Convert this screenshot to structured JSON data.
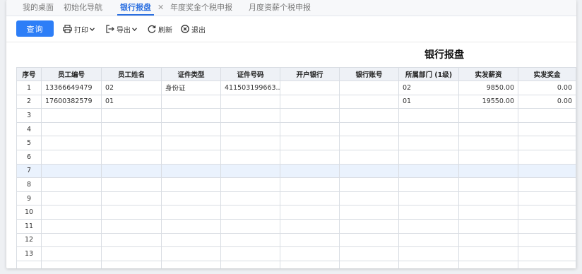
{
  "tabs": [
    {
      "label": "我的桌面",
      "active": false
    },
    {
      "label": "初始化导航",
      "active": false
    },
    {
      "label": "银行报盘",
      "active": true
    },
    {
      "label": "年度奖金个税申报",
      "active": false
    },
    {
      "label": "月度资薪个税申报",
      "active": false
    }
  ],
  "toolbar": {
    "query_label": "查询",
    "print_label": "打印",
    "export_label": "导出",
    "refresh_label": "刷新",
    "exit_label": "退出"
  },
  "report": {
    "title": "银行报盘"
  },
  "table": {
    "columns": [
      "序号",
      "员工编号",
      "员工姓名",
      "证件类型",
      "证件号码",
      "开户银行",
      "银行账号",
      "所属部门 (1级)",
      "实发薪资",
      "实发奖金"
    ],
    "rows": [
      [
        "1",
        "13366649479",
        "02",
        "身份证",
        "411503199663...",
        "",
        "",
        "02",
        "9850.00",
        "0.00"
      ],
      [
        "2",
        "17600382579",
        "01",
        "",
        "",
        "",
        "",
        "01",
        "19550.00",
        "0.00"
      ],
      [
        "3",
        "",
        "",
        "",
        "",
        "",
        "",
        "",
        "",
        ""
      ],
      [
        "4",
        "",
        "",
        "",
        "",
        "",
        "",
        "",
        "",
        ""
      ],
      [
        "5",
        "",
        "",
        "",
        "",
        "",
        "",
        "",
        "",
        ""
      ],
      [
        "6",
        "",
        "",
        "",
        "",
        "",
        "",
        "",
        "",
        ""
      ],
      [
        "7",
        "",
        "",
        "",
        "",
        "",
        "",
        "",
        "",
        ""
      ],
      [
        "8",
        "",
        "",
        "",
        "",
        "",
        "",
        "",
        "",
        ""
      ],
      [
        "9",
        "",
        "",
        "",
        "",
        "",
        "",
        "",
        "",
        ""
      ],
      [
        "10",
        "",
        "",
        "",
        "",
        "",
        "",
        "",
        "",
        ""
      ],
      [
        "11",
        "",
        "",
        "",
        "",
        "",
        "",
        "",
        "",
        ""
      ],
      [
        "12",
        "",
        "",
        "",
        "",
        "",
        "",
        "",
        "",
        ""
      ],
      [
        "13",
        "",
        "",
        "",
        "",
        "",
        "",
        "",
        "",
        ""
      ],
      [
        "",
        "",
        "",
        "",
        "",
        "",
        "",
        "",
        "",
        ""
      ]
    ],
    "highlighted_row": 6
  },
  "colors": {
    "accent": "#2d7ef7",
    "header_bg": "#eef1f6",
    "highlight_row": "#eaf2fd"
  }
}
